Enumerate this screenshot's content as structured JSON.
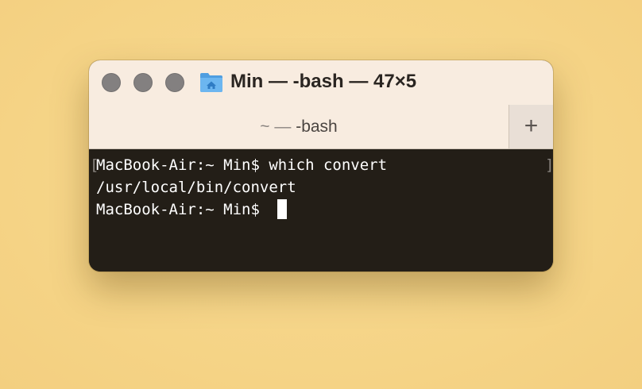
{
  "window": {
    "title": "Min — -bash — 47×5",
    "folder_icon": "home-folder-icon",
    "traffic_lights": [
      "close-button",
      "minimize-button",
      "zoom-button"
    ]
  },
  "tabs": {
    "active_tilde": "~ — ",
    "active_label": "-bash",
    "new_tab_label": "+"
  },
  "terminal": {
    "lines": [
      "MacBook-Air:~ Min$ which convert",
      "/usr/local/bin/convert",
      "MacBook-Air:~ Min$ "
    ],
    "mark_left": "[",
    "mark_right": "]"
  },
  "colors": {
    "desktop": "#f6d78a",
    "titlebar": "#f8ece0",
    "terminal_bg": "#231e17",
    "terminal_fg": "#ffffff",
    "traffic_light": "#838080",
    "folder": "#5aa8e8"
  }
}
